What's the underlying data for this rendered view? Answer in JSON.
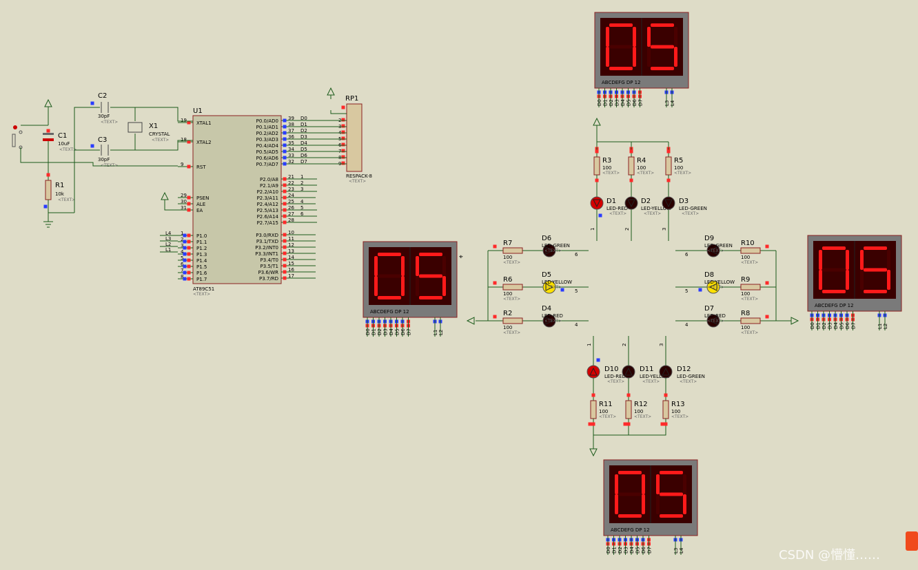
{
  "watermark": "CSDN @懵懂……",
  "mcu": {
    "ref": "U1",
    "part": "AT89C51",
    "text_placeholder": "<TEXT>",
    "left_pins": [
      {
        "num": "19",
        "name": "XTAL1"
      },
      {
        "num": "18",
        "name": "XTAL2"
      },
      {
        "num": "9",
        "name": "RST"
      },
      {
        "num": "29",
        "name": "PSEN"
      },
      {
        "num": "30",
        "name": "ALE"
      },
      {
        "num": "31",
        "name": "EA"
      },
      {
        "num": "1",
        "name": "P1.0"
      },
      {
        "num": "2",
        "name": "P1.1"
      },
      {
        "num": "3",
        "name": "P1.2"
      },
      {
        "num": "4",
        "name": "P1.3"
      },
      {
        "num": "5",
        "name": "P1.4"
      },
      {
        "num": "6",
        "name": "P1.5"
      },
      {
        "num": "7",
        "name": "P1.6"
      },
      {
        "num": "8",
        "name": "P1.7"
      }
    ],
    "right_pins": [
      {
        "num": "39",
        "name": "P0.0/AD0",
        "net": "D0"
      },
      {
        "num": "38",
        "name": "P0.1/AD1",
        "net": "D1"
      },
      {
        "num": "37",
        "name": "P0.2/AD2",
        "net": "D2"
      },
      {
        "num": "36",
        "name": "P0.3/AD3",
        "net": "D3"
      },
      {
        "num": "35",
        "name": "P0.4/AD4",
        "net": "D4"
      },
      {
        "num": "34",
        "name": "P0.5/AD5",
        "net": "D5"
      },
      {
        "num": "33",
        "name": "P0.6/AD6",
        "net": "D6"
      },
      {
        "num": "32",
        "name": "P0.7/AD7",
        "net": "D7"
      },
      {
        "num": "21",
        "name": "P2.0/A8",
        "net": "1"
      },
      {
        "num": "22",
        "name": "P2.1/A9",
        "net": "2"
      },
      {
        "num": "23",
        "name": "P2.2/A10",
        "net": "3"
      },
      {
        "num": "24",
        "name": "P2.3/A11",
        "net": ""
      },
      {
        "num": "25",
        "name": "P2.4/A12",
        "net": "4"
      },
      {
        "num": "26",
        "name": "P2.5/A13",
        "net": "5"
      },
      {
        "num": "27",
        "name": "P2.6/A14",
        "net": "6"
      },
      {
        "num": "28",
        "name": "P2.7/A15",
        "net": ""
      },
      {
        "num": "10",
        "name": "P3.0/RXD",
        "net": ""
      },
      {
        "num": "11",
        "name": "P3.1/TXD",
        "net": ""
      },
      {
        "num": "12",
        "name": "P3.2/INT0",
        "net": ""
      },
      {
        "num": "13",
        "name": "P3.3/INT1",
        "net": ""
      },
      {
        "num": "14",
        "name": "P3.4/T0",
        "net": ""
      },
      {
        "num": "15",
        "name": "P3.5/T1",
        "net": ""
      },
      {
        "num": "16",
        "name": "P3.6/WR",
        "net": ""
      },
      {
        "num": "17",
        "name": "P3.7/RD",
        "net": ""
      }
    ],
    "p1_nets": [
      "L4",
      "L3",
      "L2",
      "L1"
    ]
  },
  "rp1": {
    "ref": "RP1",
    "part": "RESPACK-8",
    "pins": [
      "2",
      "3",
      "4",
      "5",
      "6",
      "7",
      "8",
      "9"
    ]
  },
  "c1": {
    "ref": "C1",
    "value": "10uF"
  },
  "c2": {
    "ref": "C2",
    "value": "30pF"
  },
  "c3": {
    "ref": "C3",
    "value": "30pF"
  },
  "x1": {
    "ref": "X1",
    "value": "CRYSTAL"
  },
  "r1": {
    "ref": "R1",
    "value": "10k"
  },
  "text_placeholder": "<TEXT>",
  "displays": {
    "value": "05",
    "label": "ABCDEFG  DP     12",
    "pin_labels": [
      "D0",
      "D1",
      "D2",
      "D3",
      "D4",
      "D5",
      "D6",
      "D7"
    ],
    "digit_pins": [
      "L3",
      "L4"
    ],
    "digit_pins_alt": [
      "L1",
      "L2"
    ]
  },
  "resistors": [
    {
      "ref": "R3",
      "value": "100"
    },
    {
      "ref": "R4",
      "value": "100"
    },
    {
      "ref": "R5",
      "value": "100"
    },
    {
      "ref": "R7",
      "value": "100"
    },
    {
      "ref": "R6",
      "value": "100"
    },
    {
      "ref": "R2",
      "value": "100"
    },
    {
      "ref": "R10",
      "value": "100"
    },
    {
      "ref": "R9",
      "value": "100"
    },
    {
      "ref": "R8",
      "value": "100"
    },
    {
      "ref": "R11",
      "value": "100"
    },
    {
      "ref": "R12",
      "value": "100"
    },
    {
      "ref": "R13",
      "value": "100"
    }
  ],
  "leds": {
    "D1": "LED-RED",
    "D2": "LED-YELLOW",
    "D3": "LED-GREEN",
    "D6": "LED-GREEN",
    "D5": "LED-YELLOW",
    "D4": "LED-RED",
    "D9": "LED-GREEN",
    "D8": "LED-YELLOW",
    "D7": "LED-RED",
    "D10": "LED-RED",
    "D11": "LED-YELLOW",
    "D12": "LED-GREEN"
  },
  "colors": {
    "background": "#dedcc7",
    "wire": "#1a5a1a",
    "body": "#c7c7a9",
    "outline": "#8b2020",
    "segment_on": "#ff1a1a",
    "led_red_on": "#d40000",
    "led_yellow_on": "#ffe000"
  }
}
